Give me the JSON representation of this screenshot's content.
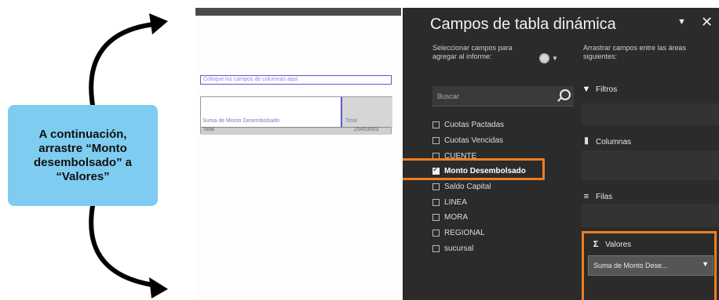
{
  "callout": {
    "text": "A continuación, arrastre “Monto desembolsado” a “Valores”"
  },
  "sheet": {
    "drag_hint": "Coloque los campos de columnas aquí",
    "pivot_header_label": "Suma de Monto Desembolsado",
    "pivot_total_header": "Total",
    "pivot_total_row_label": "Total",
    "pivot_total_value": "25453003"
  },
  "pane": {
    "title": "Campos de tabla dinámica",
    "menu_icon": "dropdown-arrow",
    "close_icon": "close",
    "choose_label": "Seleccionar campos para agregar al informe:",
    "drag_label": "Arrastrar campos entre las áreas siguientes:",
    "search_placeholder": "Buscar",
    "fields": [
      {
        "label": "Cuotas Pactadas",
        "checked": false
      },
      {
        "label": "Cuotas Vencidas",
        "checked": false
      },
      {
        "label": "CUENTE",
        "checked": false
      },
      {
        "label": "Monto Desembolsado",
        "checked": true
      },
      {
        "label": "Saldo Capital",
        "checked": false
      },
      {
        "label": "LINEA",
        "checked": false
      },
      {
        "label": "MORA",
        "checked": false
      },
      {
        "label": "REGIONAL",
        "checked": false
      },
      {
        "label": "sucursal",
        "checked": false
      }
    ],
    "areas": {
      "filters": "Filtros",
      "columns": "Columnas",
      "rows": "Filas",
      "values": "Valores",
      "values_chip": "Suma de Monto Dese..."
    },
    "highlight_color": "#ef7d22"
  }
}
